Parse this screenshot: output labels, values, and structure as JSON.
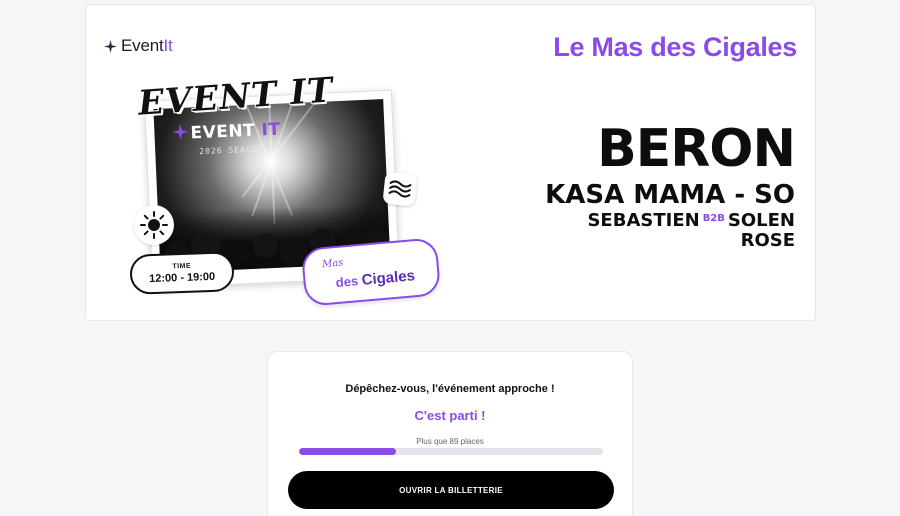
{
  "brand": {
    "logo_text": "Event",
    "logo_accent": "It",
    "accent_color": "#8a4be8"
  },
  "hero": {
    "venue_title": "Le Mas des Cigales",
    "poster": {
      "big_title": "EVENT IT",
      "inner_title_main": "EVENT ",
      "inner_title_accent": "IT",
      "season": "2026 SEASON",
      "time_label": "TIME",
      "time_value": "12:00 - 19:00",
      "badge_mas": "Mas",
      "badge_des": "des ",
      "badge_cigales": "Cigales"
    },
    "lineup": {
      "headliner": "BERON",
      "line2": "KASA MAMA - SO",
      "line3_left": "SEBASTIEN",
      "line3_b2b": "B2B",
      "line3_right": "SOLEN",
      "line4": "ROSE"
    }
  },
  "ticket": {
    "hurry_text": "Dépêchez-vous, l'événement approche !",
    "status_text": "C'est parti !",
    "places_text": "Plus que 89 places",
    "progress_fraction": 0.32,
    "cta_label": "OUVRIR LA BILLETTERIE"
  }
}
